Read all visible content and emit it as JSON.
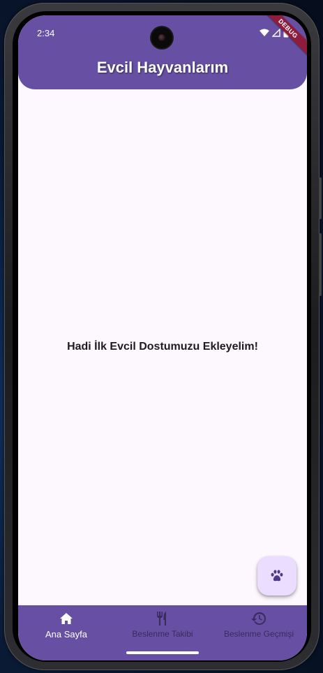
{
  "status_bar": {
    "time": "2:34",
    "debug_label": "DEBUG"
  },
  "app_bar": {
    "title": "Evcil Hayvanlarım"
  },
  "main": {
    "empty_message": "Hadi İlk Evcil Dostumuzu Ekleyelim!"
  },
  "fab": {
    "icon": "paw-icon"
  },
  "bottom_nav": {
    "items": [
      {
        "label": "Ana Sayfa",
        "icon": "home-icon",
        "active": true
      },
      {
        "label": "Beslenme Takibi",
        "icon": "restaurant-icon",
        "active": false
      },
      {
        "label": "Beslenme Geçmişi",
        "icon": "history-icon",
        "active": false
      }
    ]
  },
  "colors": {
    "primary": "#6750a4",
    "background": "#fdf7fe",
    "fab": "#eaddff",
    "inactive_nav": "#3a2a5e",
    "debug_banner": "#8f1c3a"
  }
}
